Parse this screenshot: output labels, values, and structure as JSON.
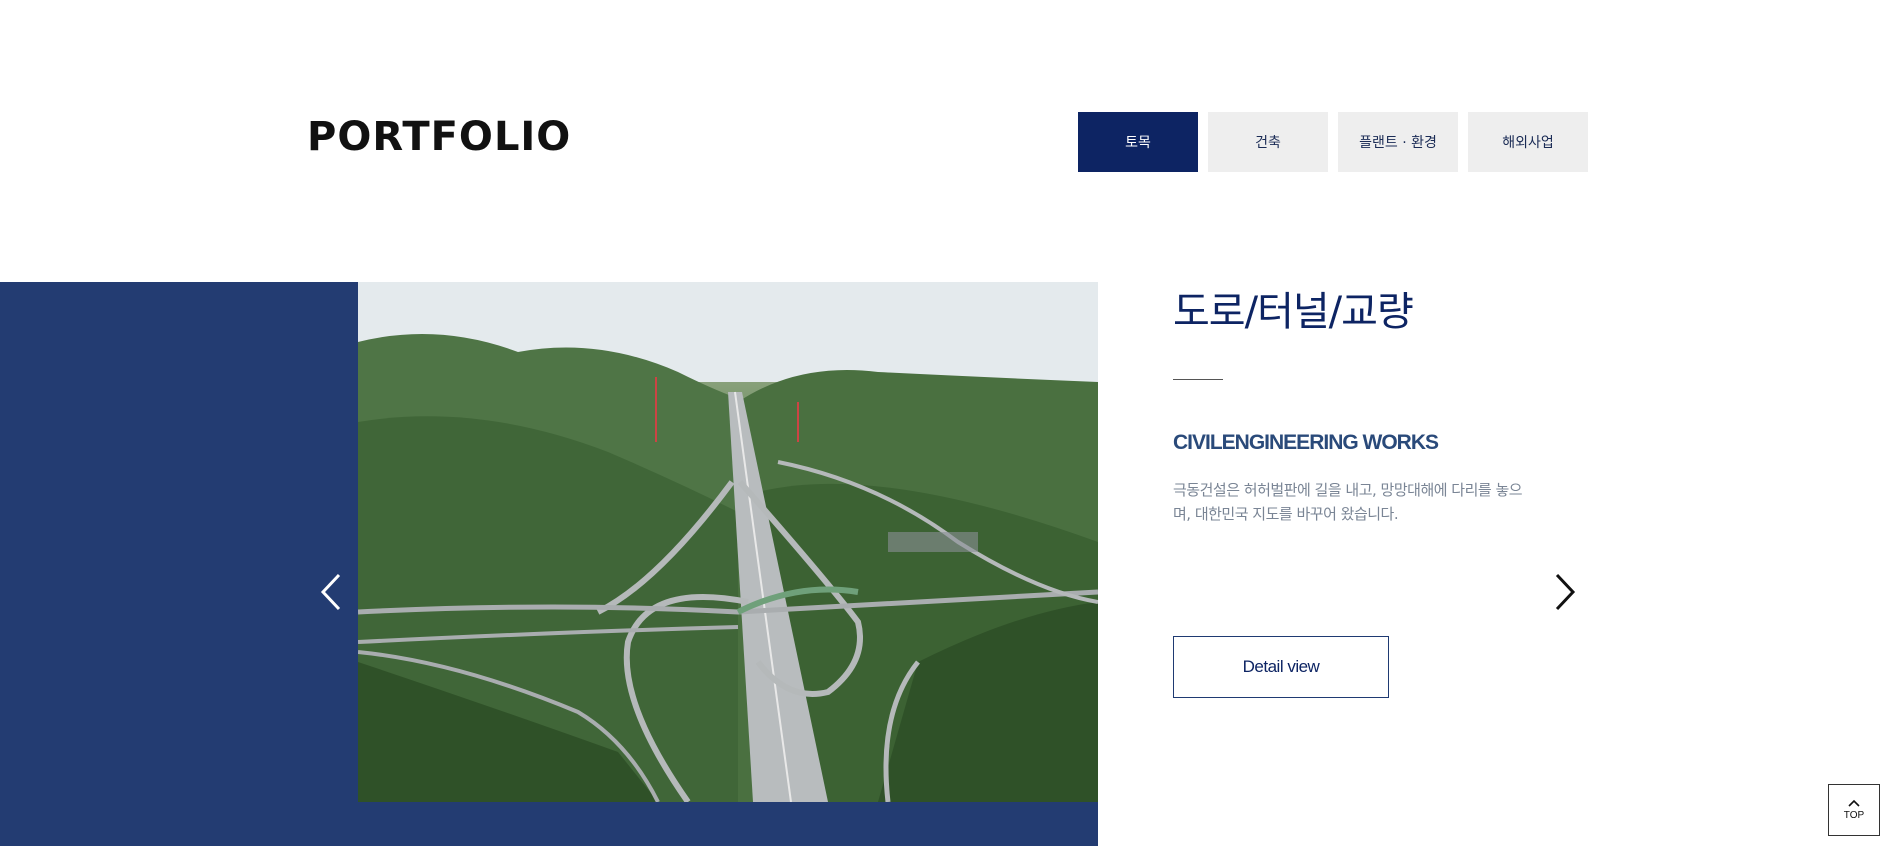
{
  "header": {
    "title": "PORTFOLIO"
  },
  "tabs": [
    {
      "label": "토목",
      "active": true
    },
    {
      "label": "건축",
      "active": false
    },
    {
      "label": "플랜트 · 환경",
      "active": false
    },
    {
      "label": "해외사업",
      "active": false
    }
  ],
  "slide": {
    "image_alt": "aerial highway interchange through green hills",
    "title": "도로/터널/교량",
    "subtitle": "CIVILENGINEERING WORKS",
    "description": "극동건설은 허허벌판에 길을 내고, 망망대해에 다리를 놓으며, 대한민국 지도를 바꾸어 왔습니다.",
    "detail_label": "Detail view"
  },
  "nav": {
    "prev_icon": "chevron-left-icon",
    "next_icon": "chevron-right-icon"
  },
  "top_button": {
    "label": "TOP",
    "icon": "chevron-up-icon"
  },
  "colors": {
    "navy": "#0d2463",
    "panel_blue": "#233c72",
    "tab_bg": "#eeeeee",
    "text_gray": "#7a8595"
  }
}
